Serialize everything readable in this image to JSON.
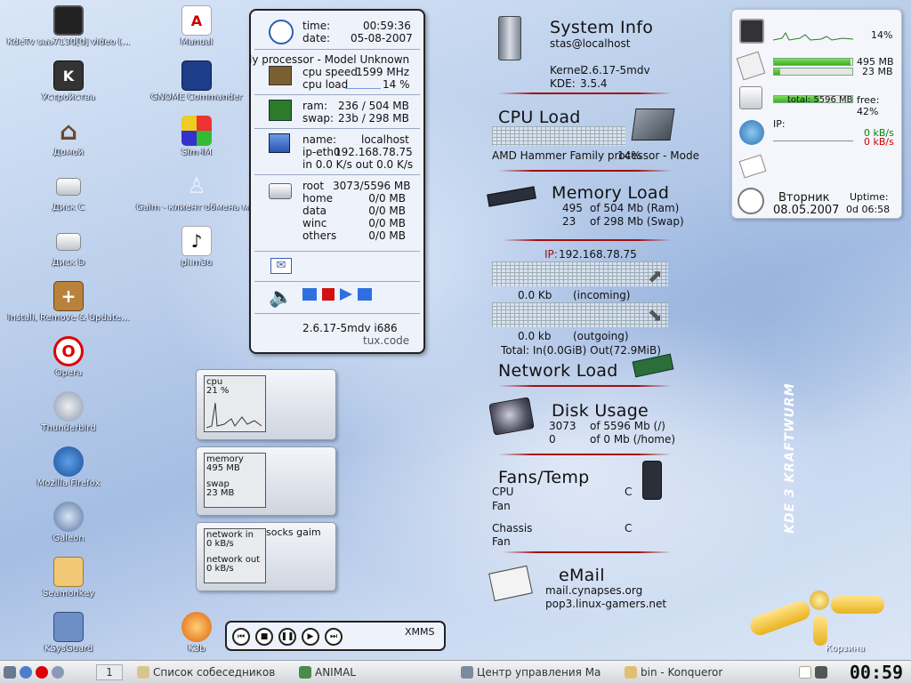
{
  "desktop_icons_left": [
    {
      "label": "KdeTv saa7130[0] video (...",
      "icon": "tv-icon"
    },
    {
      "label": "Устройства",
      "icon": "devices-icon"
    },
    {
      "label": "Домой",
      "icon": "home-icon"
    },
    {
      "label": "Диск C",
      "icon": "disk-icon"
    },
    {
      "label": "Диск D",
      "icon": "disk-icon"
    },
    {
      "label": "Install, Remove & Update...",
      "icon": "package-icon"
    },
    {
      "label": "Opera",
      "icon": "opera-icon"
    },
    {
      "label": "Thunderbird",
      "icon": "thunderbird-icon"
    },
    {
      "label": "Mozilla Firefox",
      "icon": "firefox-icon"
    },
    {
      "label": "Galeon",
      "icon": "galeon-icon"
    },
    {
      "label": "Seamonkey",
      "icon": "seamonkey-icon"
    },
    {
      "label": "KSysGuard",
      "icon": "ksysguard-icon"
    }
  ],
  "desktop_icons_right": [
    {
      "label": "Manual",
      "icon": "pdf-icon"
    },
    {
      "label": "GNOME Commander",
      "icon": "floppy-icon"
    },
    {
      "label": "Sim-IM",
      "icon": "simim-icon"
    },
    {
      "label": "Gaim - клиент обмена м...",
      "icon": "gaim-icon"
    },
    {
      "label": "pl.m3u",
      "icon": "music-note-icon"
    },
    {
      "label": "K3b",
      "icon": "k3b-icon"
    }
  ],
  "tux": {
    "time_label": "time:",
    "time": "00:59:36",
    "date_label": "date:",
    "date": "05-08-2007",
    "cpu_model": "ly processor - Model Unknown",
    "cpu_speed_label": "cpu speed",
    "cpu_speed": "1599 MHz",
    "cpu_load_label": "cpu load",
    "cpu_load": "14 %",
    "ram_label": "ram:",
    "ram": "236 / 504 MB",
    "swap_label": "swap:",
    "swap": "23b / 298 MB",
    "name_label": "name:",
    "name": "localhost",
    "ip_label": "ip-eth0",
    "ip": "192.168.78.75",
    "net": "in 0.0 K/s out 0.0 K/s",
    "disks": [
      {
        "label": "root",
        "value": "3073/5596 MB"
      },
      {
        "label": "home",
        "value": "0/0 MB"
      },
      {
        "label": "data",
        "value": "0/0 MB"
      },
      {
        "label": "winc",
        "value": "0/0 MB"
      },
      {
        "label": "others",
        "value": "0/0 MB"
      }
    ],
    "kernel": "2.6.17-5mdv i686",
    "brand": "tux.code"
  },
  "sysinfo": {
    "title": "System Info",
    "user": "stas@localhost",
    "kernel_label": "Kernel",
    "kernel": "2.6.17-5mdv",
    "kde_label": "KDE:",
    "kde": "3.5.4"
  },
  "cpu": {
    "title": "CPU Load",
    "model": "AMD Hammer Family processor - Mode",
    "load": "14%"
  },
  "memory": {
    "title": "Memory Load",
    "ram_used": "495",
    "ram_text": "of 504 Mb (Ram)",
    "swap_used": "23",
    "swap_text": "of 298 Mb (Swap)"
  },
  "network": {
    "ip_label": "IP:",
    "ip": "192.168.78.75",
    "in_value": "0.0 Kb",
    "in_label": "(incoming)",
    "out_value": "0.0 kb",
    "out_label": "(outgoing)",
    "total": "Total: In(0.0GiB)  Out(72.9MiB)",
    "title": "Network Load"
  },
  "disk": {
    "title": "Disk Usage",
    "root_used": "3073",
    "root_text": "of 5596 Mb (/)",
    "home_used": "0",
    "home_text": "of 0 Mb (/home)"
  },
  "fans": {
    "title": "Fans/Temp",
    "cpu": "CPU",
    "cpu_unit": "C",
    "fan1": "Fan",
    "chassis": "Chassis",
    "chassis_unit": "C",
    "fan2": "Fan"
  },
  "email": {
    "title": "eMail",
    "line1": "mail.cynapses.org",
    "line2": "pop3.linux-gamers.net"
  },
  "monitors": {
    "cpu_label": "cpu",
    "cpu_value": "21 %",
    "mem_label": "memory",
    "mem_value": "495 MB",
    "swap_label": "swap",
    "swap_value": "23 MB",
    "socks": "socks gaim",
    "netin_label": "network in",
    "netin_value": "0 kB/s",
    "netout_label": "network out",
    "netout_value": "0 kB/s"
  },
  "rpanel": {
    "cpu_pct": "14%",
    "cpu_level": 0.14,
    "mem1": "495 MB",
    "mem1_level": 0.98,
    "mem2": "23 MB",
    "mem2_level": 0.08,
    "disk_total": "total: 5596 MB",
    "disk_free": "free: 42%",
    "disk_level": 0.58,
    "ip_label": "IP:",
    "net_in": "0 kB/s",
    "net_out": "0 kB/s",
    "day": "Вторник",
    "date": "08.05.2007",
    "uptime_label": "Uptime:",
    "uptime": "0d 06:58"
  },
  "xmms_label": "XMMS",
  "trash_label": "Корзина",
  "kde_brand": "KDE 3 KRAFTWURM",
  "taskbar": {
    "desktop_num": "1",
    "tasks": [
      {
        "label": "Список собеседников",
        "icon": "gaim-icon"
      },
      {
        "label": "ANIMAL",
        "icon": "animal-icon"
      },
      {
        "label": "Центр управления Ма",
        "icon": "control-center-icon"
      },
      {
        "label": "bin - Konqueror",
        "icon": "konqueror-icon"
      }
    ],
    "clock": "00:59"
  },
  "colors": {
    "accent_red": "#a01010",
    "bar_green": "#3fae23",
    "net_out_red": "#d00000",
    "net_in_green": "#008800"
  }
}
